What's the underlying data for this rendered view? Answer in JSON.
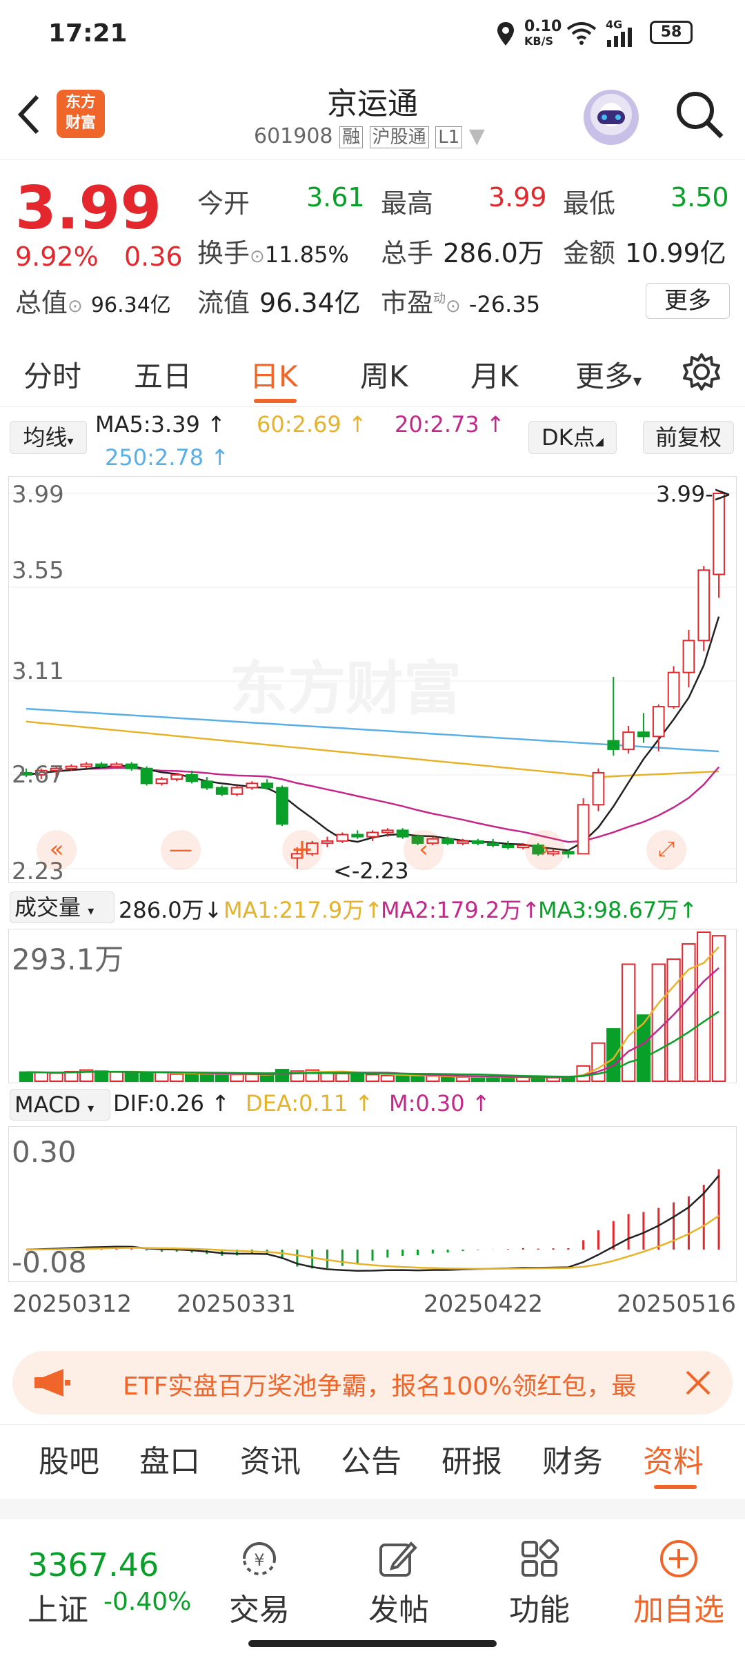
{
  "status": {
    "time": "17:21",
    "net_speed": "0.10",
    "net_unit": "KB/S",
    "signal": "4G",
    "battery": "58"
  },
  "header": {
    "title": "京运通",
    "code": "601908",
    "badge1": "融",
    "badge2": "沪股通",
    "badge3": "L1",
    "logo_line1": "东方",
    "logo_line2": "财富"
  },
  "quote": {
    "price": "3.99",
    "pct": "9.92%",
    "chg": "0.36",
    "open_label": "今开",
    "open": "3.61",
    "high_label": "最高",
    "high": "3.99",
    "low_label": "最低",
    "low": "3.50",
    "turnover_label": "换手",
    "turnover": "11.85%",
    "vol_label": "总手",
    "vol": "286.0万",
    "amt_label": "金额",
    "amt": "10.99亿",
    "mktcap_label": "总值",
    "mktcap": "96.34亿",
    "float_label": "流值",
    "float": "96.34亿",
    "pe_label": "市盈",
    "pe_sup": "动",
    "pe": "-26.35",
    "more": "更多"
  },
  "ktabs": [
    "分时",
    "五日",
    "日K",
    "周K",
    "月K",
    "更多"
  ],
  "ma": {
    "selector": "均线",
    "ma5": "MA5:3.39",
    "ma60": "60:2.69",
    "ma20": "20:2.73",
    "ma250": "250:2.78",
    "dk": "DK点",
    "fq": "前复权"
  },
  "kchart": {
    "ylabels": [
      "3.99",
      "3.55",
      "3.11",
      "2.67",
      "2.23"
    ],
    "high_mark": "3.99->",
    "low_mark": "<-2.23",
    "watermark": "东方财富",
    "ymin": 2.23,
    "ymax": 3.99
  },
  "volume": {
    "selector": "成交量",
    "value": "286.0万",
    "ma1": "MA1:217.9万",
    "ma2": "MA2:179.2万",
    "ma3": "MA3:98.67万",
    "max_label": "293.1万"
  },
  "macd": {
    "selector": "MACD",
    "dif": "DIF:0.26",
    "dea": "DEA:0.11",
    "m": "M:0.30",
    "top_label": "0.30",
    "bottom_label": "-0.08"
  },
  "dates": [
    "20250312",
    "20250331",
    "20250422",
    "20250516"
  ],
  "banner": {
    "text": "ETF实盘百万奖池争霸，报名100%领红包，最"
  },
  "bottom_tabs": [
    "股吧",
    "盘口",
    "资讯",
    "公告",
    "研报",
    "财务",
    "资料"
  ],
  "dock": {
    "index_value": "3367.46",
    "index_name": "上证",
    "index_chg": "-0.40%",
    "trade": "交易",
    "post": "发帖",
    "func": "功能",
    "add": "加自选"
  },
  "chart_data": {
    "type": "candlestick",
    "ohlc": [
      [
        2.68,
        2.7,
        2.66,
        2.67
      ],
      [
        2.67,
        2.7,
        2.65,
        2.69
      ],
      [
        2.69,
        2.71,
        2.66,
        2.7
      ],
      [
        2.7,
        2.72,
        2.69,
        2.71
      ],
      [
        2.71,
        2.73,
        2.7,
        2.72
      ],
      [
        2.72,
        2.73,
        2.7,
        2.71
      ],
      [
        2.71,
        2.73,
        2.7,
        2.72
      ],
      [
        2.72,
        2.73,
        2.69,
        2.7
      ],
      [
        2.7,
        2.71,
        2.62,
        2.63
      ],
      [
        2.63,
        2.66,
        2.62,
        2.65
      ],
      [
        2.65,
        2.68,
        2.64,
        2.67
      ],
      [
        2.67,
        2.69,
        2.63,
        2.64
      ],
      [
        2.64,
        2.66,
        2.6,
        2.61
      ],
      [
        2.61,
        2.62,
        2.57,
        2.58
      ],
      [
        2.58,
        2.62,
        2.57,
        2.61
      ],
      [
        2.61,
        2.64,
        2.6,
        2.63
      ],
      [
        2.63,
        2.65,
        2.6,
        2.61
      ],
      [
        2.61,
        2.62,
        2.43,
        2.44
      ],
      [
        2.28,
        2.33,
        2.23,
        2.3
      ],
      [
        2.3,
        2.36,
        2.29,
        2.35
      ],
      [
        2.35,
        2.38,
        2.33,
        2.36
      ],
      [
        2.36,
        2.4,
        2.35,
        2.39
      ],
      [
        2.39,
        2.41,
        2.37,
        2.38
      ],
      [
        2.38,
        2.41,
        2.36,
        2.4
      ],
      [
        2.4,
        2.42,
        2.38,
        2.41
      ],
      [
        2.41,
        2.42,
        2.37,
        2.38
      ],
      [
        2.38,
        2.39,
        2.34,
        2.35
      ],
      [
        2.35,
        2.38,
        2.34,
        2.37
      ],
      [
        2.37,
        2.38,
        2.34,
        2.35
      ],
      [
        2.35,
        2.37,
        2.34,
        2.36
      ],
      [
        2.36,
        2.37,
        2.34,
        2.35
      ],
      [
        2.35,
        2.37,
        2.33,
        2.34
      ],
      [
        2.34,
        2.36,
        2.32,
        2.33
      ],
      [
        2.33,
        2.35,
        2.32,
        2.34
      ],
      [
        2.34,
        2.35,
        2.29,
        2.3
      ],
      [
        2.3,
        2.32,
        2.29,
        2.31
      ],
      [
        2.31,
        2.32,
        2.28,
        2.3
      ],
      [
        2.3,
        2.56,
        2.3,
        2.53
      ],
      [
        2.53,
        2.7,
        2.5,
        2.68
      ],
      [
        2.83,
        3.13,
        2.76,
        2.79
      ],
      [
        2.79,
        2.9,
        2.77,
        2.87
      ],
      [
        2.87,
        2.96,
        2.82,
        2.85
      ],
      [
        2.85,
        3.0,
        2.78,
        2.99
      ],
      [
        2.99,
        3.18,
        2.98,
        3.15
      ],
      [
        3.15,
        3.35,
        3.08,
        3.3
      ],
      [
        3.3,
        3.65,
        3.25,
        3.63
      ],
      [
        3.61,
        3.99,
        3.5,
        3.99
      ]
    ],
    "volume": [
      18,
      17,
      16,
      19,
      22,
      20,
      18,
      16,
      15,
      17,
      14,
      15,
      13,
      12,
      13,
      14,
      12,
      23,
      20,
      22,
      16,
      15,
      14,
      13,
      11,
      10,
      9,
      10,
      8,
      8,
      9,
      8,
      7,
      9,
      8,
      7,
      8,
      30,
      75,
      103,
      230,
      130,
      230,
      240,
      270,
      293,
      286
    ],
    "ma5_label": "MA5:3.39",
    "ma20_label": "20:2.73",
    "ma60_label": "60:2.69",
    "ma250_label": "250:2.78",
    "ylim": [
      2.23,
      3.99
    ],
    "x_labels": [
      "20250312",
      "20250331",
      "20250422",
      "20250516"
    ]
  }
}
